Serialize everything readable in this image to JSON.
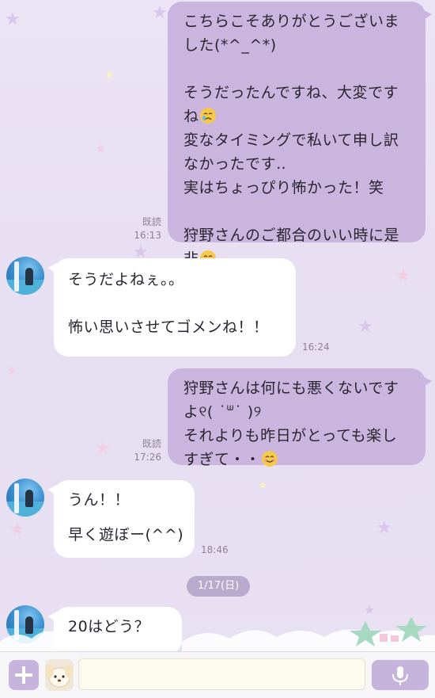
{
  "messages": [
    {
      "direction": "outgoing",
      "lines": [
        "こちらこそありがとうございま",
        "した(*^_^*)",
        "",
        "そうだったんですね、大変です",
        "ね",
        "変なタイミングで私いて申し訳",
        "なかったです‥",
        "実はちょっぴり怖かった！笑",
        "",
        "狩野さんのご都合のいい時に是",
        "非"
      ],
      "read": "既読",
      "time": "16:13"
    },
    {
      "direction": "incoming",
      "lines": [
        "そうだよねぇ。。",
        "",
        "怖い思いさせてゴメンね！！"
      ],
      "time": "16:24"
    },
    {
      "direction": "outgoing",
      "lines": [
        "狩野さんは何にも悪くないです",
        "よ୧( ˙ᐜ˙ )୨",
        "それよりも昨日がとっても楽し",
        "すぎて・・"
      ],
      "read": "既読",
      "time": "17:26"
    },
    {
      "direction": "incoming",
      "lines": [
        "うん！！",
        "",
        "早く遊ぼー(^^)"
      ],
      "time": "18:46"
    },
    {
      "direction": "incoming",
      "lines": [
        "20はどう？"
      ],
      "time": ""
    }
  ],
  "date_separator": "1/17(日)",
  "input": {
    "placeholder": ""
  },
  "icons": {
    "add": "plus-icon",
    "sticker": "sticker-character-icon",
    "mic": "microphone-icon",
    "crying_emoji": "crying-face-emoji",
    "smile_emoji": "smiling-face-emoji"
  },
  "colors": {
    "outgoing_bubble": "#c9b5de",
    "incoming_bubble": "#ffffff",
    "accent": "#c6b4dd"
  }
}
